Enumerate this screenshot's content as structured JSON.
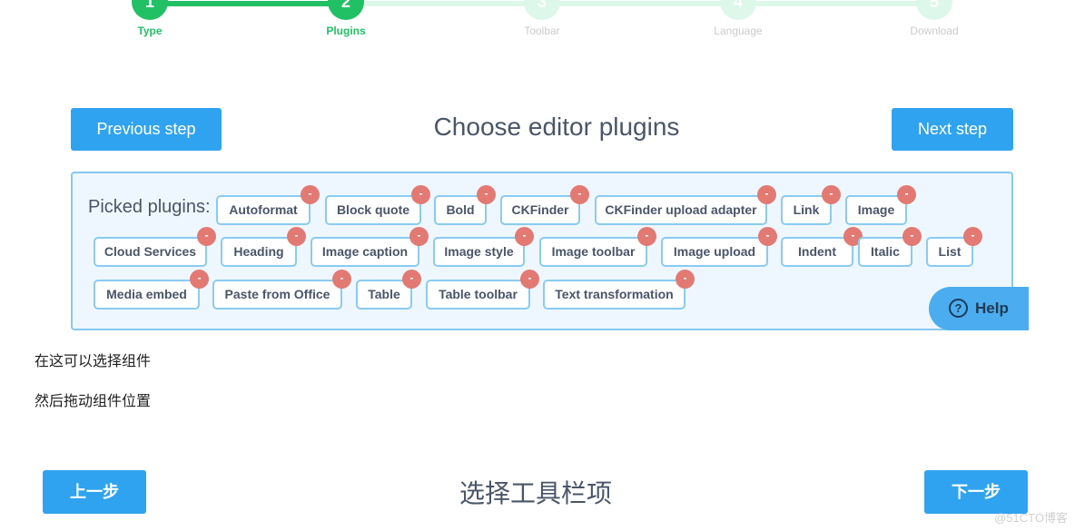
{
  "stepper": {
    "steps": [
      {
        "number": "1",
        "label": "Type",
        "state": "done"
      },
      {
        "number": "2",
        "label": "Plugins",
        "state": "done"
      },
      {
        "number": "3",
        "label": "Toolbar",
        "state": "todo"
      },
      {
        "number": "4",
        "label": "Language",
        "state": "todo"
      },
      {
        "number": "5",
        "label": "Download",
        "state": "todo"
      }
    ]
  },
  "nav": {
    "previous_label": "Previous step",
    "next_label": "Next step",
    "heading": "Choose editor plugins"
  },
  "plugins": {
    "label": "Picked plugins:",
    "remove_symbol": "-",
    "items": [
      "Autoformat",
      "Block quote",
      "Bold",
      "CKFinder",
      "CKFinder upload adapter",
      "Link",
      "Image",
      "Cloud Services",
      "Heading",
      "Image caption",
      "Image style",
      "Image toolbar",
      "Image upload",
      "Indent",
      "Italic",
      "List",
      "Media embed",
      "Paste from Office",
      "Table",
      "Table toolbar",
      "Text transformation"
    ]
  },
  "help": {
    "icon": "?",
    "label": "Help"
  },
  "notes": [
    "在这可以选择组件",
    "然后拖动组件位置"
  ],
  "nav_cn": {
    "previous_label": "上一步",
    "next_label": "下一步",
    "heading": "选择工具栏项"
  },
  "watermark": "@51CTO博客"
}
